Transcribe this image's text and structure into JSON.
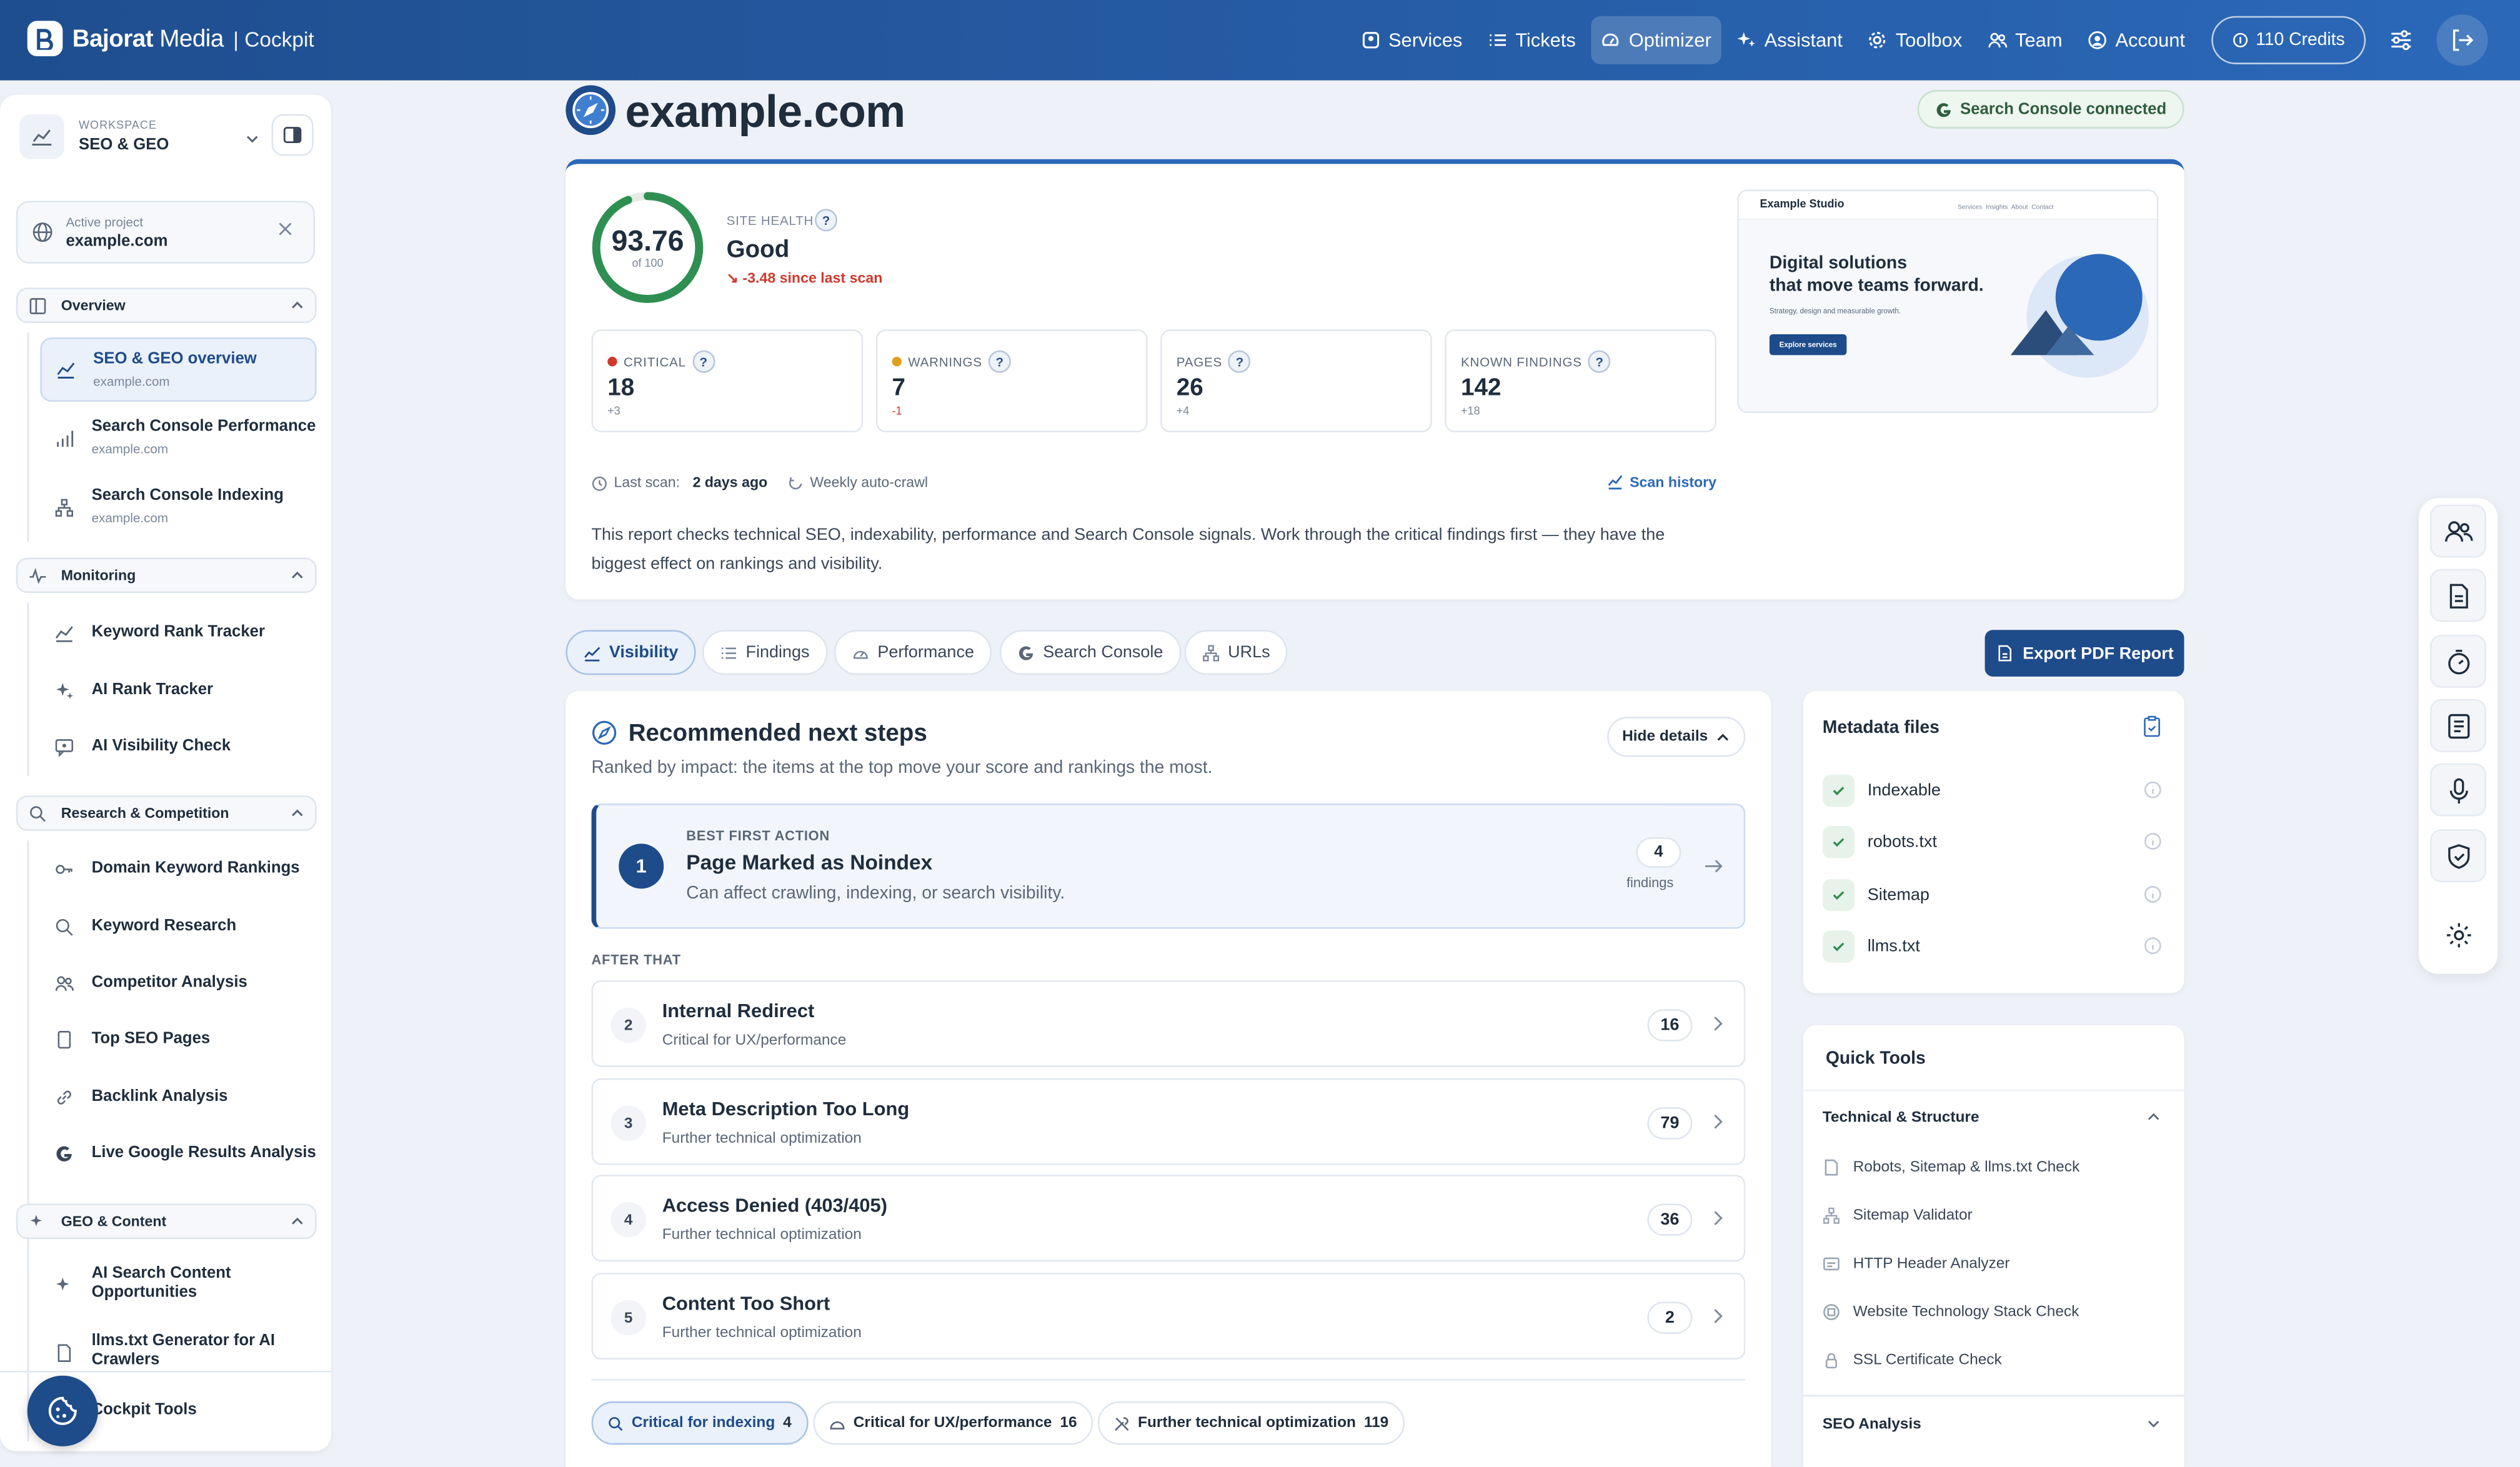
{
  "brand": {
    "name": "Bajorat",
    "name2": " Media",
    "sub": "| Cockpit"
  },
  "nav": {
    "services": "Services",
    "tickets": "Tickets",
    "optimizer": "Optimizer",
    "assistant": "Assistant",
    "toolbox": "Toolbox",
    "team": "Team",
    "account": "Account",
    "credits": "110 Credits"
  },
  "sidebar": {
    "workspace_small": "WORKSPACE",
    "workspace_name": "SEO & GEO",
    "project_small": "Active project",
    "project_name": "example.com",
    "sections": {
      "overview": "Overview",
      "monitoring": "Monitoring",
      "research": "Research & Competition",
      "geo": "GEO & Content"
    },
    "items": {
      "seo_overview": "SEO & GEO overview",
      "seo_overview_sub": "example.com",
      "gsc_perf": "Search Console Performance",
      "gsc_perf_sub": "example.com",
      "gsc_index": "Search Console Indexing",
      "gsc_index_sub": "example.com",
      "rank_tracker": "Keyword Rank Tracker",
      "ai_rank": "AI Rank Tracker",
      "ai_visibility": "AI Visibility Check",
      "domain_kw": "Domain Keyword Rankings",
      "kw_research": "Keyword Research",
      "competitor": "Competitor Analysis",
      "top_pages": "Top SEO Pages",
      "backlink": "Backlink Analysis",
      "live_google": "Live Google Results Analysis",
      "ai_content_1": "AI Search Content",
      "ai_content_2": "Opportunities",
      "llms_gen_1": "llms.txt Generator for AI",
      "llms_gen_2": "Crawlers",
      "cockpit_tools": "Cockpit Tools"
    }
  },
  "header": {
    "site": "example.com",
    "gsc": "Search Console connected"
  },
  "health": {
    "score": "93.76",
    "score_sub": "of 100",
    "score_fraction": 0.9376,
    "label": "SITE HEALTH",
    "value": "Good",
    "delta": "-3.48 since last scan"
  },
  "stats": [
    {
      "label": "CRITICAL",
      "value": "18",
      "delta": "+3",
      "color": "#d0392c"
    },
    {
      "label": "WARNINGS",
      "value": "7",
      "delta": "-1",
      "color": "#e0a020"
    },
    {
      "label": "PAGES",
      "value": "26",
      "delta": "+4"
    },
    {
      "label": "KNOWN FINDINGS",
      "value": "142",
      "delta": "+18"
    }
  ],
  "scan": {
    "last_label": "Last scan:",
    "last_value": "2 days ago",
    "auto": "Weekly auto-crawl",
    "history": "Scan history"
  },
  "description": "This report checks technical SEO, indexability, performance and Search Console signals. Work through the critical findings first — they have the biggest effect on rankings and visibility.",
  "preview": {
    "brand": "Example Studio",
    "nav": "Services  Insights  About  Contact",
    "headline1": "Digital solutions",
    "headline2": "that move teams forward.",
    "sub": "Strategy, design and measurable growth.",
    "cta": "Explore services"
  },
  "tabs": [
    "Visibility",
    "Findings",
    "Performance",
    "Search Console",
    "URLs"
  ],
  "export_label": "Export PDF Report",
  "rec": {
    "title": "Recommended next steps",
    "sub": "Ranked by impact: the items at the top move your score and rankings the most.",
    "hide": "Hide details",
    "best_small": "BEST FIRST ACTION",
    "best_num": "1",
    "best_title": "Page Marked as Noindex",
    "best_sub": "Can affect crawling, indexing, or search visibility.",
    "best_count": "4",
    "best_findings": "findings",
    "after": "AFTER THAT",
    "rows": [
      {
        "num": "2",
        "title": "Internal Redirect",
        "sub": "Critical for UX/performance",
        "count": "16"
      },
      {
        "num": "3",
        "title": "Meta Description Too Long",
        "sub": "Further technical optimization",
        "count": "79"
      },
      {
        "num": "4",
        "title": "Access Denied (403/405)",
        "sub": "Further technical optimization",
        "count": "36"
      },
      {
        "num": "5",
        "title": "Content Too Short",
        "sub": "Further technical optimization",
        "count": "2"
      }
    ],
    "chips": [
      {
        "label": "Critical for indexing",
        "count": "4"
      },
      {
        "label": "Critical for UX/performance",
        "count": "16"
      },
      {
        "label": "Further technical optimization",
        "count": "119"
      }
    ]
  },
  "metadata": {
    "title": "Metadata files",
    "items": [
      "Indexable",
      "robots.txt",
      "Sitemap",
      "llms.txt"
    ]
  },
  "quick_tools": {
    "title": "Quick Tools",
    "section": "Technical & Structure",
    "items": [
      "Robots, Sitemap & llms.txt Check",
      "Sitemap Validator",
      "HTTP Header Analyzer",
      "Website Technology Stack Check",
      "SSL Certificate Check"
    ],
    "seo_section": "SEO Analysis"
  },
  "colors": {
    "primary": "#1e4b8a",
    "topbar": "#2b68b8",
    "critical": "#d0392c",
    "warning": "#e0a020",
    "good": "#2f8f52"
  }
}
